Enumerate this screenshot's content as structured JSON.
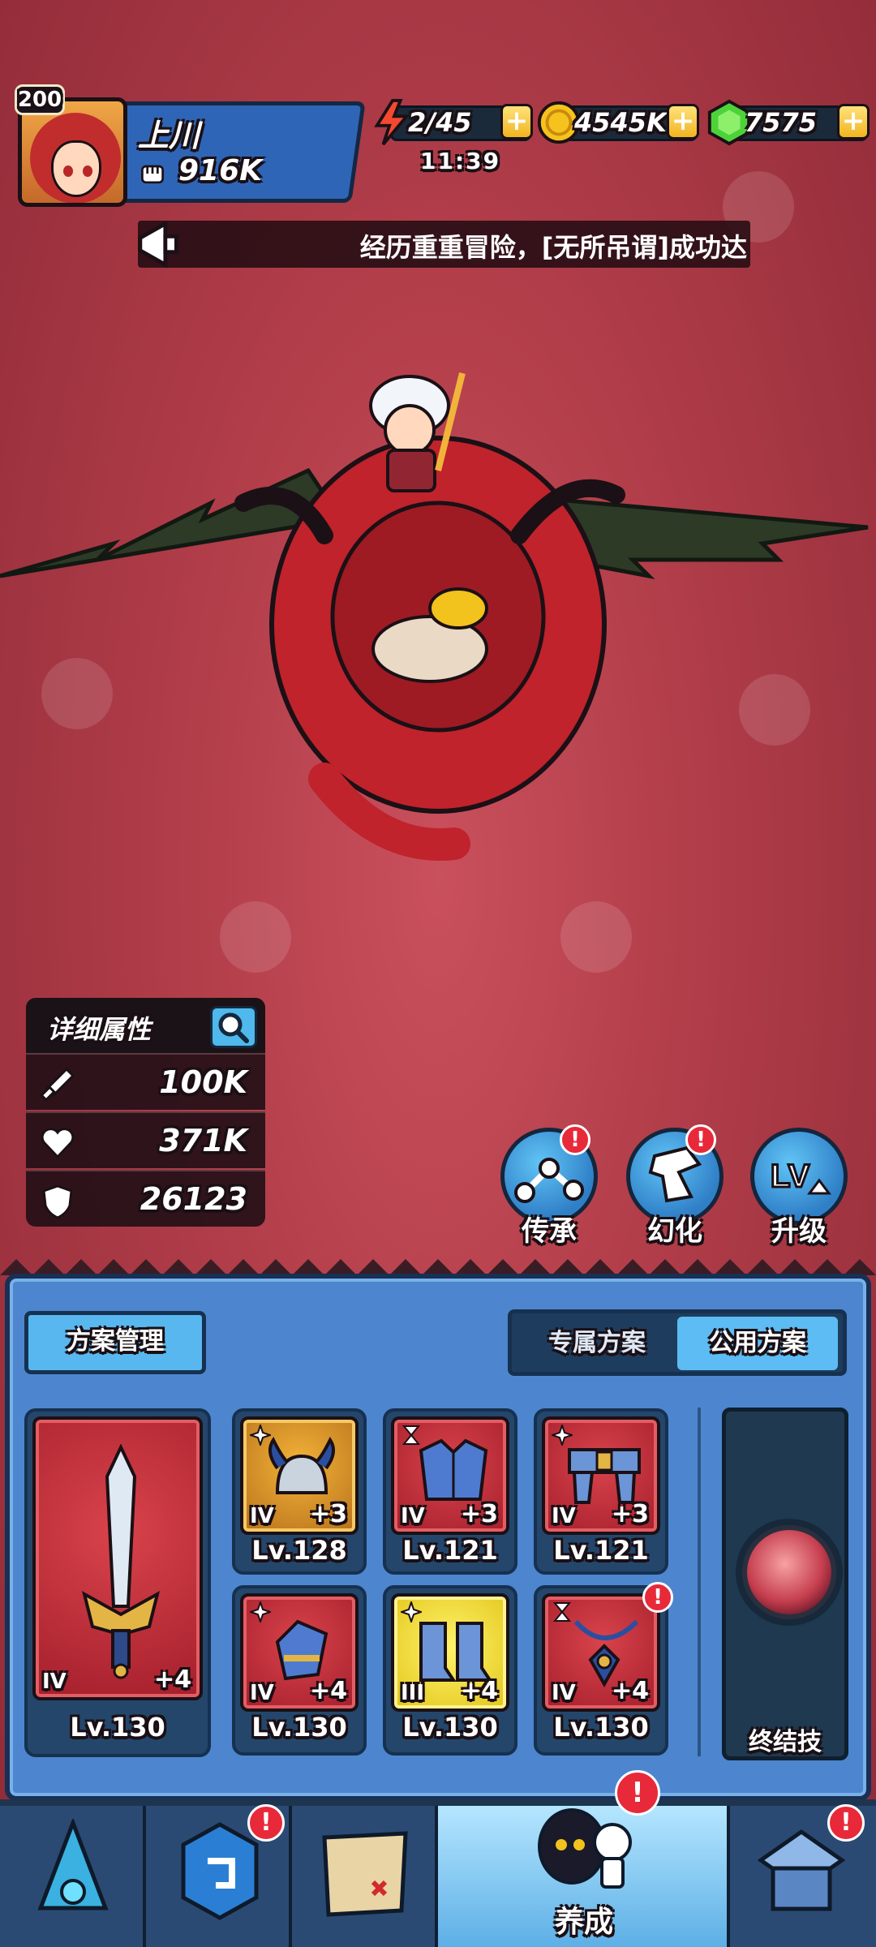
{
  "player": {
    "level": "200",
    "name": "上川",
    "power": "916K"
  },
  "resources": {
    "energy": "2/45",
    "energy_timer": "11:39",
    "gold": "4545K",
    "gems": "7575",
    "plus": "+"
  },
  "ticker": {
    "text": "经历重重冒险，[无所吊谓]成功达"
  },
  "stats": {
    "title": "详细属性",
    "attack": "100K",
    "hp": "371K",
    "defense": "26123"
  },
  "actions": [
    {
      "label": "传承",
      "badge": "!"
    },
    {
      "label": "幻化",
      "badge": "!"
    },
    {
      "label": "升级",
      "badge": ""
    }
  ],
  "plans": {
    "manage_label": "方案管理",
    "tab_exclusive": "专属方案",
    "tab_public": "公用方案"
  },
  "equipment": {
    "weapon": {
      "tier": "IV",
      "plus": "+4",
      "level": "Lv.130"
    },
    "helmet": {
      "tier": "IV",
      "plus": "+3",
      "level": "Lv.128"
    },
    "armor": {
      "tier": "IV",
      "plus": "+3",
      "level": "Lv.121"
    },
    "belt": {
      "tier": "IV",
      "plus": "+3",
      "level": "Lv.121"
    },
    "gloves": {
      "tier": "IV",
      "plus": "+4",
      "level": "Lv.130"
    },
    "boots": {
      "tier": "III",
      "plus": "+4",
      "level": "Lv.130"
    },
    "necklace": {
      "tier": "IV",
      "plus": "+4",
      "level": "Lv.130",
      "badge": "!"
    }
  },
  "ultimate": {
    "label": "终结技"
  },
  "nav": {
    "active_label": "养成",
    "badge": "!"
  },
  "colors": {
    "background": "#b23e4a",
    "panel_blue": "#4d86cf",
    "button_blue": "#58b7ee",
    "badge_red": "#e8293a",
    "slot_red": "#a41f2c",
    "slot_gold": "#b8701c",
    "slot_yellow": "#e2c51a"
  }
}
